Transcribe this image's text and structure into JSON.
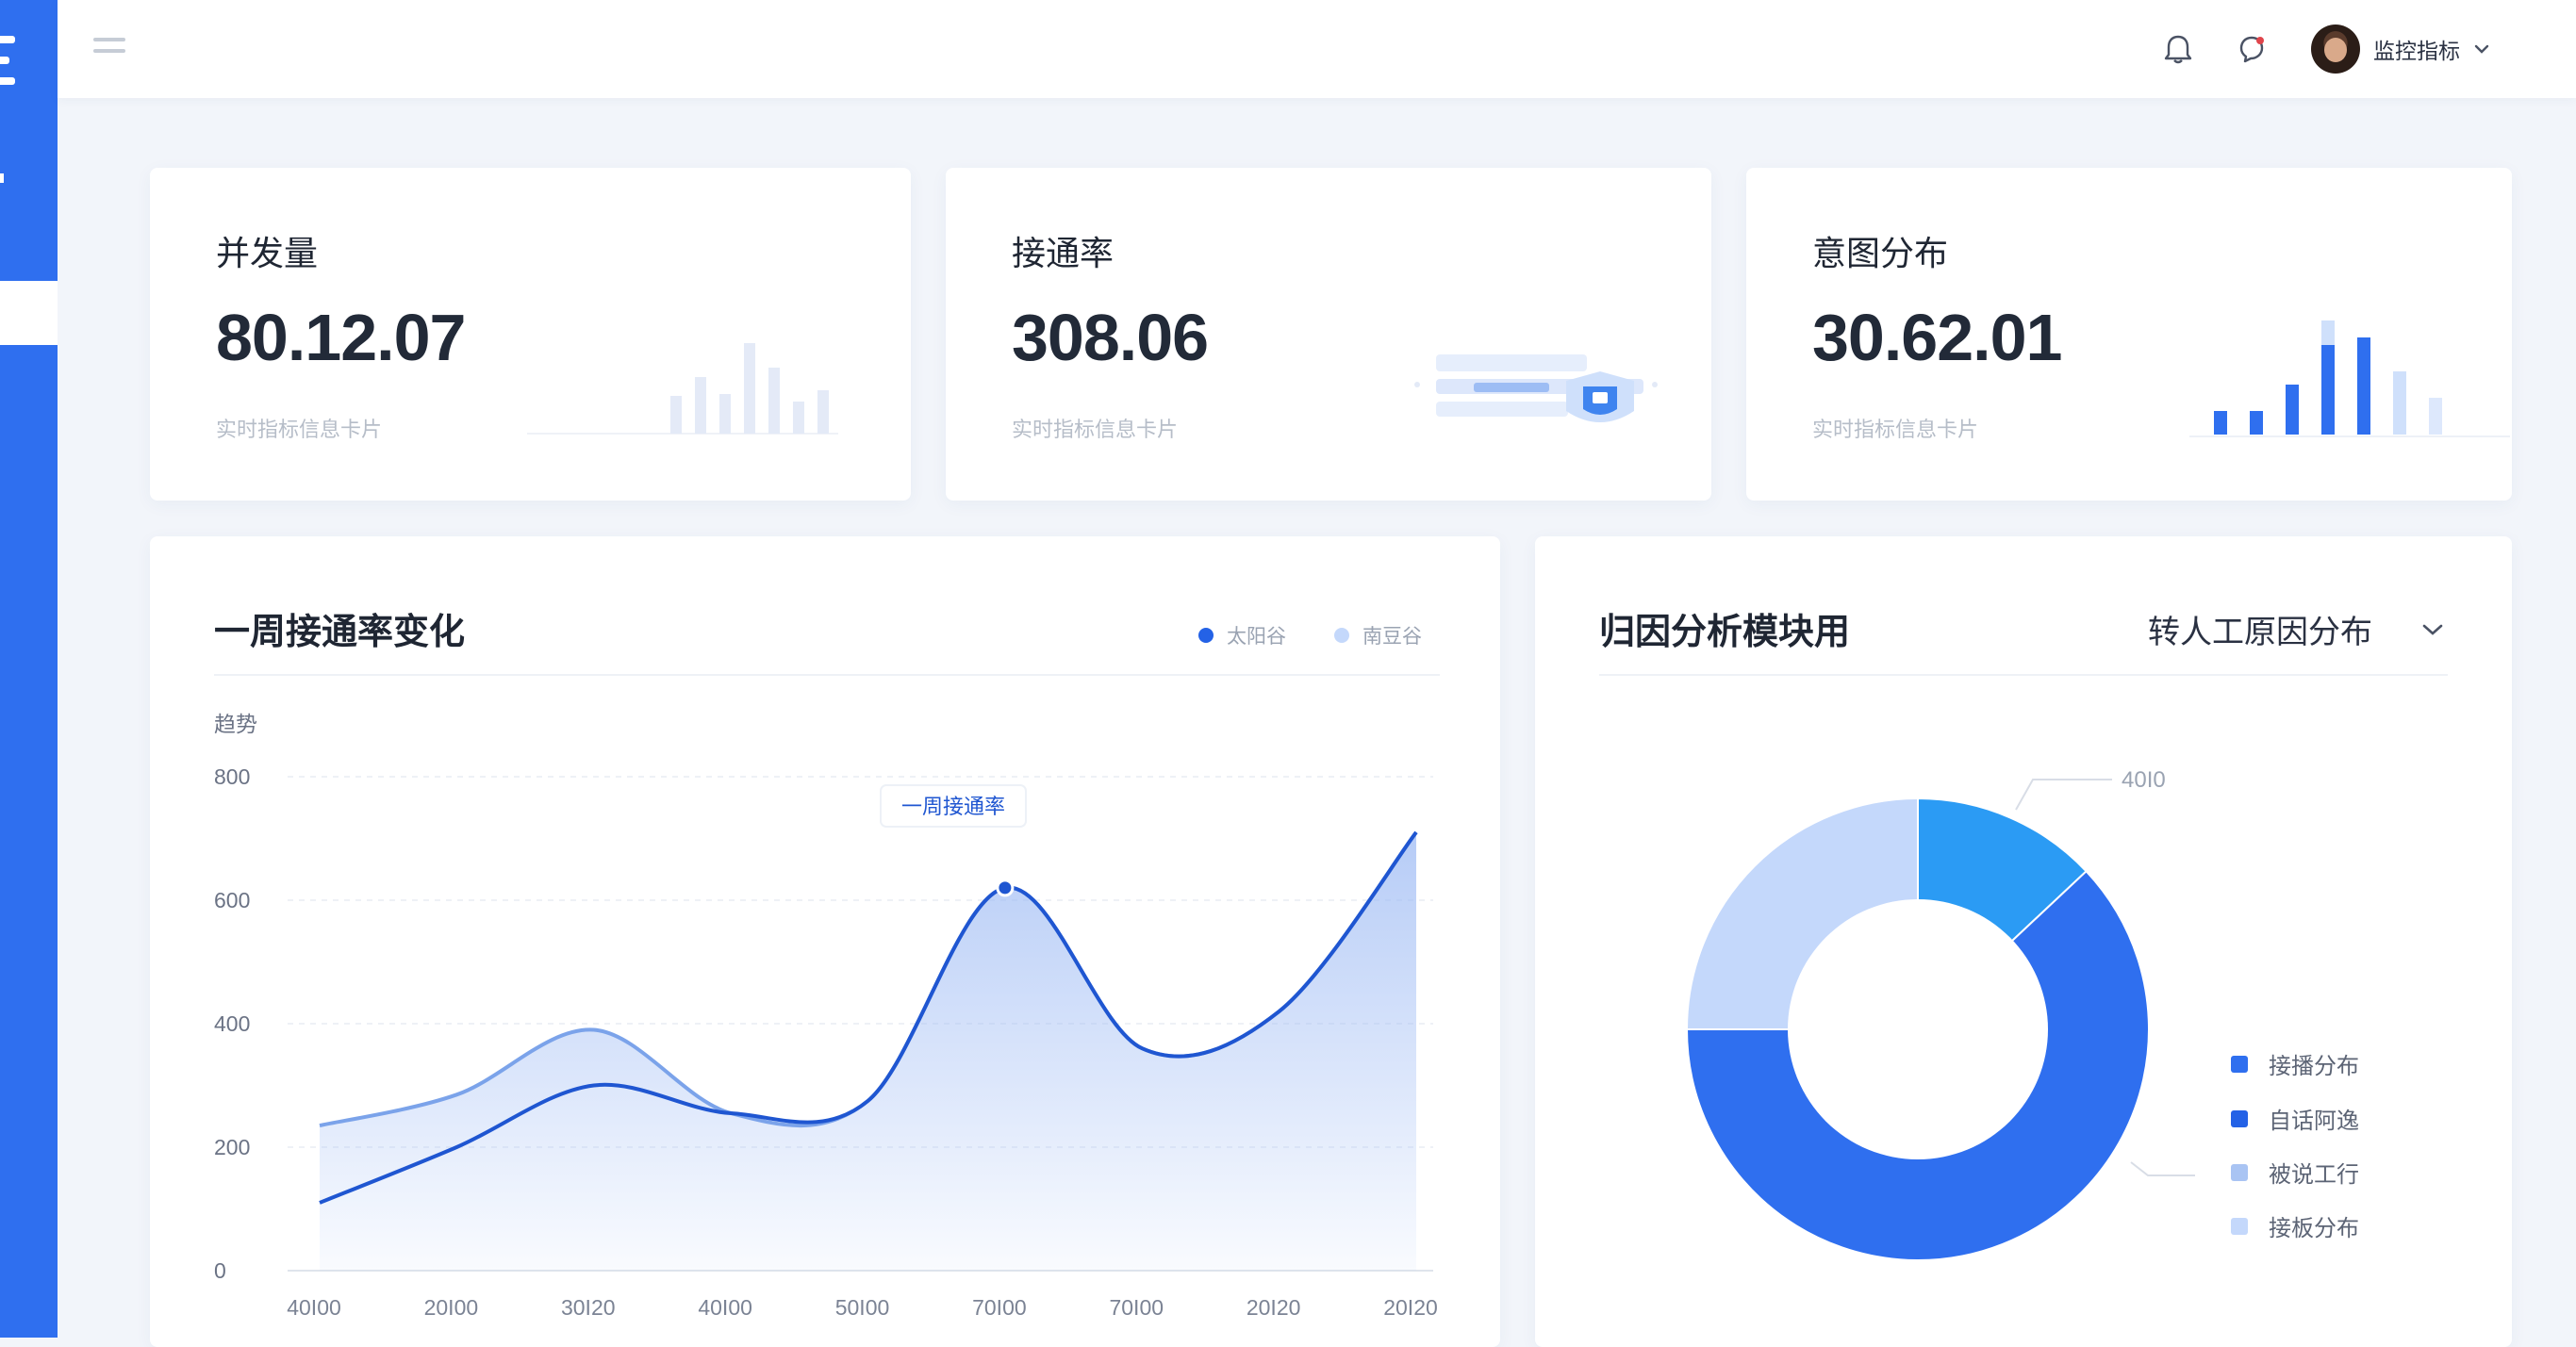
{
  "header": {
    "user_name": "监控指标"
  },
  "stats": [
    {
      "title": "并发量",
      "value": "80.12.07",
      "sub": "实时指标信息卡片"
    },
    {
      "title": "接通率",
      "value": "308.06",
      "sub": "实时指标信息卡片"
    },
    {
      "title": "意图分布",
      "value": "30.62.01",
      "sub": "实时指标信息卡片"
    }
  ],
  "line_panel": {
    "title": "一周接通率变化",
    "legend": [
      {
        "label": "太阳谷",
        "color": "#2462e6"
      },
      {
        "label": "南豆谷",
        "color": "#c4d8fb"
      }
    ],
    "y_title": "趋势",
    "tooltip": "一周接通率"
  },
  "pie_panel": {
    "title": "归因分析模块用",
    "dropdown": "转人工原因分布",
    "callout": "40I0",
    "legend": [
      {
        "label": "接播分布",
        "color": "#2f6fef"
      },
      {
        "label": "自话阿逸",
        "color": "#2462e6"
      },
      {
        "label": "被说工行",
        "color": "#a9c4f3"
      },
      {
        "label": "接板分布",
        "color": "#c4d8fb"
      }
    ]
  },
  "chart_data": [
    {
      "type": "area",
      "title": "一周接通率变化",
      "ylabel": "趋势",
      "categories": [
        "40I00",
        "20I00",
        "30I20",
        "40I00",
        "50I00",
        "70I00",
        "70I00",
        "20I20",
        "20I20"
      ],
      "ylim": [
        0,
        800
      ],
      "yticks": [
        0,
        200,
        400,
        600,
        800
      ],
      "grid": true,
      "legend_position": "top-right",
      "series": [
        {
          "name": "太阳谷",
          "values": [
            110,
            200,
            300,
            255,
            275,
            620,
            360,
            420,
            710
          ]
        },
        {
          "name": "南豆谷",
          "values": [
            235,
            285,
            390,
            255,
            275,
            620,
            360,
            420,
            710
          ]
        }
      ]
    },
    {
      "type": "pie",
      "title": "归因分析模块用",
      "donut": true,
      "categories": [
        "接播分布",
        "自话阿逸",
        "被说工行",
        "接板分布"
      ],
      "values": [
        13,
        62,
        0,
        25
      ],
      "colors": [
        "#2b9bf4",
        "#2f6fef",
        "#a9c4f3",
        "#c4d8fb"
      ],
      "legend_position": "right"
    }
  ]
}
